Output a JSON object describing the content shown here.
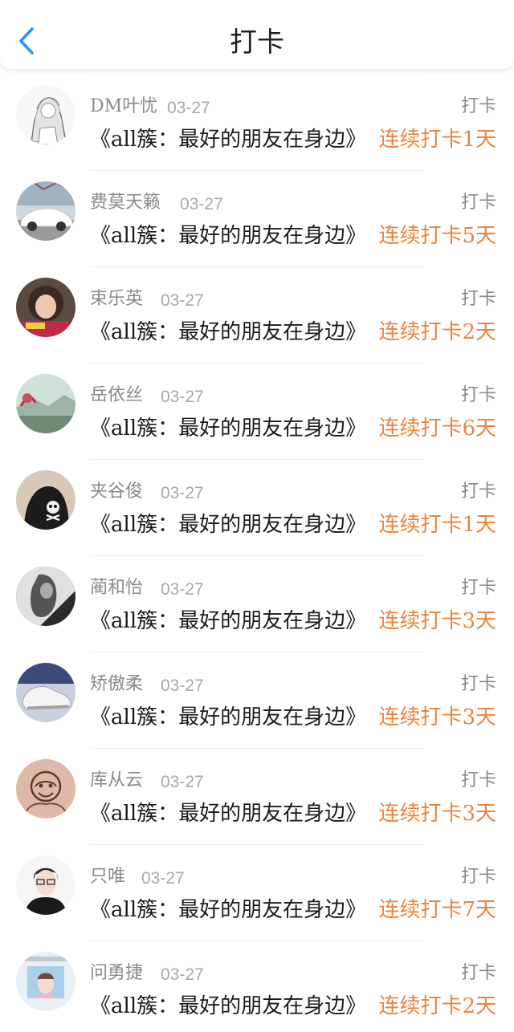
{
  "header": {
    "title": "打卡",
    "back_icon": "chevron-left-icon",
    "accent_color": "#2196f3"
  },
  "colors": {
    "streak": "#e8853f",
    "meta": "#8a8a8a"
  },
  "items": [
    {
      "name": "DM叶忧",
      "date": "03-27",
      "action": "打卡",
      "book": "《all簇：最好的朋友在身边》",
      "streak": "连续打卡1天",
      "avatar": "avatar-sketch-girl"
    },
    {
      "name": "费莫天籁",
      "date": "03-27",
      "action": "打卡",
      "book": "《all簇：最好的朋友在身边》",
      "streak": "连续打卡5天",
      "avatar": "avatar-white-car"
    },
    {
      "name": "束乐英",
      "date": "03-27",
      "action": "打卡",
      "book": "《all簇：最好的朋友在身边》",
      "streak": "连续打卡2天",
      "avatar": "avatar-girl-portrait"
    },
    {
      "name": "岳依丝",
      "date": "03-27",
      "action": "打卡",
      "book": "《all簇：最好的朋友在身边》",
      "streak": "连续打卡6天",
      "avatar": "avatar-landscape"
    },
    {
      "name": "夹谷俊",
      "date": "03-27",
      "action": "打卡",
      "book": "《all簇：最好的朋友在身边》",
      "streak": "连续打卡1天",
      "avatar": "avatar-skull-hoodie"
    },
    {
      "name": "蔺和怡",
      "date": "03-27",
      "action": "打卡",
      "book": "《all簇：最好的朋友在身边》",
      "streak": "连续打卡3天",
      "avatar": "avatar-bw-photo"
    },
    {
      "name": "矫傲柔",
      "date": "03-27",
      "action": "打卡",
      "book": "《all簇：最好的朋友在身边》",
      "streak": "连续打卡3天",
      "avatar": "avatar-sneakers"
    },
    {
      "name": "库从云",
      "date": "03-27",
      "action": "打卡",
      "book": "《all簇：最好的朋友在身边》",
      "streak": "连续打卡3天",
      "avatar": "avatar-tattoo"
    },
    {
      "name": "只唯",
      "date": "03-27",
      "action": "打卡",
      "book": "《all簇：最好的朋友在身边》",
      "streak": "连续打卡7天",
      "avatar": "avatar-boy-glasses"
    },
    {
      "name": "问勇捷",
      "date": "03-27",
      "action": "打卡",
      "book": "《all簇：最好的朋友在身边》",
      "streak": "连续打卡2天",
      "avatar": "avatar-pastel-boy"
    }
  ]
}
